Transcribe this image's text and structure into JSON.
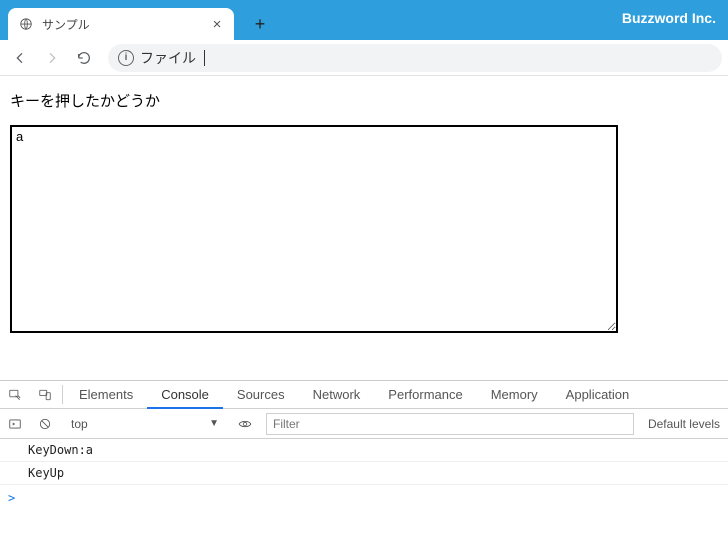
{
  "brand": "Buzzword Inc.",
  "tab": {
    "title": "サンプル"
  },
  "omnibox": {
    "label": "ファイル"
  },
  "page": {
    "heading": "キーを押したかどうか",
    "textarea_value": "a"
  },
  "devtools": {
    "tabs": {
      "elements": "Elements",
      "console": "Console",
      "sources": "Sources",
      "network": "Network",
      "performance": "Performance",
      "memory": "Memory",
      "application": "Application"
    },
    "context": "top",
    "filter_placeholder": "Filter",
    "levels_label": "Default levels",
    "log": [
      "KeyDown:a",
      "KeyUp"
    ],
    "prompt": ">"
  }
}
